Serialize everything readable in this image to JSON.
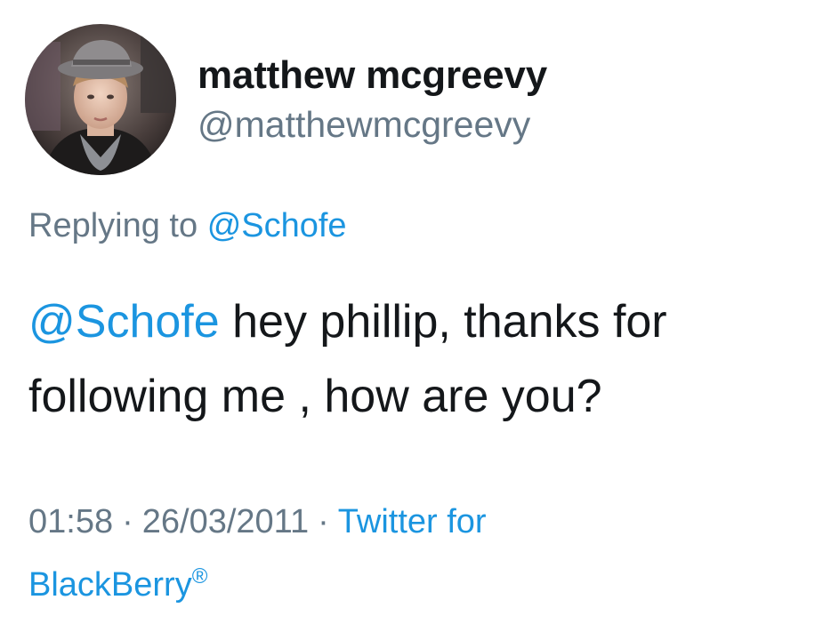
{
  "tweet": {
    "author": {
      "display_name": "matthew mcgreevy",
      "handle": "@matthewmcgreevy",
      "avatar_icon": "profile-photo"
    },
    "replying_to": {
      "prefix": "Replying to",
      "mention": "@Schofe"
    },
    "body": {
      "mention": "@Schofe",
      "text": " hey phillip, thanks for following me , how are you?"
    },
    "meta": {
      "time": "01:58",
      "separator": "·",
      "date": "26/03/2011",
      "source_line1": "Twitter for",
      "source_line2": "BlackBerry",
      "source_mark": "®"
    },
    "colors": {
      "link": "#1b95e0",
      "secondary_text": "#657786",
      "primary_text": "#14171a",
      "background": "#ffffff"
    }
  }
}
